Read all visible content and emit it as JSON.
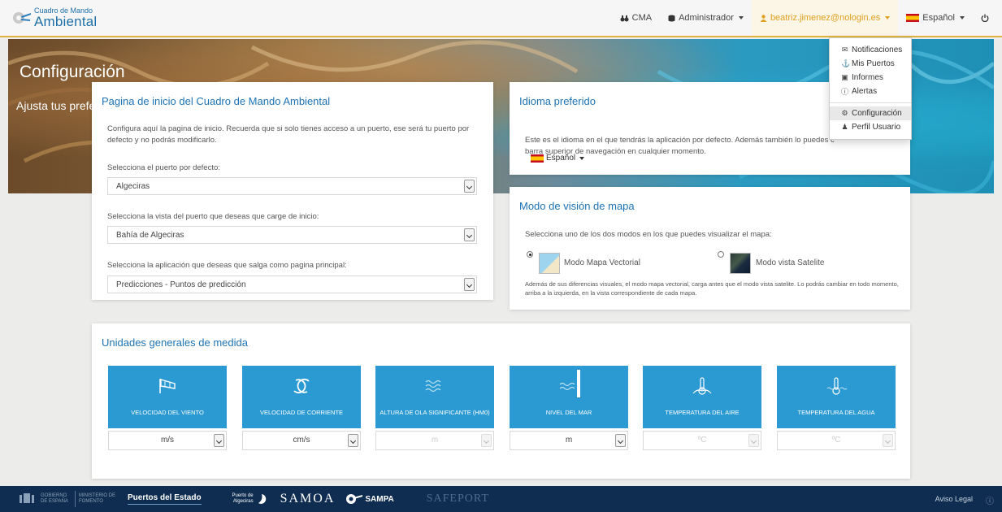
{
  "navbar": {
    "brand_small": "Cuadro de Mando",
    "brand_big": "Ambiental",
    "cma_label": "CMA",
    "admin_label": "Administrador",
    "user_label": "beatriz.jimenez@nologin.es",
    "language_label": "Español"
  },
  "user_menu": {
    "items": [
      {
        "label": "Notificaciones",
        "icon": "envelope-icon"
      },
      {
        "label": "Mis Puertos",
        "icon": "anchor-icon"
      },
      {
        "label": "Informes",
        "icon": "report-icon"
      },
      {
        "label": "Alertas",
        "icon": "alert-icon"
      },
      {
        "label": "Configuración",
        "icon": "gear-icon"
      },
      {
        "label": "Perfil Usuario",
        "icon": "user-icon"
      }
    ]
  },
  "hero": {
    "title": "Configuración",
    "subtitle": "Ajusta tus prefe"
  },
  "home_card": {
    "title": "Pagina de inicio del Cuadro de Mando Ambiental",
    "description": "Configura aquí la pagina de inicio. Recuerda que si solo tienes acceso a un puerto, ese será tu puerto por defecto y no podrás modificarlo.",
    "port_label": "Selecciona el puerto por defecto:",
    "port_value": "Algeciras",
    "view_label": "Selecciona la vista del puerto que deseas que carge de inicio:",
    "view_value": "Bahía de Algeciras",
    "app_label": "Selecciona la aplicación que deseas que salga como pagina principal:",
    "app_value": "Predicciones - Puntos de predicción"
  },
  "language_card": {
    "title": "Idioma preferido",
    "description": "Este es el idioma en el que tendrás la aplicación por defecto. Además también lo puedes c barra superior de navegación en cualquier momento.",
    "language_value": "Español"
  },
  "map_card": {
    "title": "Modo de visión de mapa",
    "description": "Selecciona uno de los dos modos en los que puedes visualizar el mapa:",
    "vector_label": "Modo Mapa Vectorial",
    "satellite_label": "Modo vista Satelite",
    "note": "Además de sus diferencias visuales, el modo mapa vectorial, carga antes que el modo vista satelite. Lo podrás cambiar en todo momento, arriba a la izquierda, en la vista correspondiente de cada mapa.",
    "selected": "vector"
  },
  "units_card": {
    "title": "Unidades generales de medida",
    "tiles": [
      {
        "label": "VELOCIDAD DEL VIENTO",
        "unit": "m/s",
        "icon": "windsock-icon",
        "enabled": true
      },
      {
        "label": "VELOCIDAD DE CORRIENTE",
        "unit": "cm/s",
        "icon": "refresh-icon",
        "enabled": true
      },
      {
        "label": "ALTURA DE OLA SIGNIFICANTE (HM0)",
        "unit": "m",
        "icon": "waves-icon",
        "enabled": false
      },
      {
        "label": "NIVEL DEL MAR",
        "unit": "m",
        "icon": "sea-level-icon",
        "enabled": true
      },
      {
        "label": "TEMPERATURA DEL AIRE",
        "unit": "ºC",
        "icon": "air-temperature-icon",
        "enabled": false
      },
      {
        "label": "TEMPERATURA DEL AGUA",
        "unit": "ºC",
        "icon": "water-temperature-icon",
        "enabled": false
      }
    ]
  },
  "footer": {
    "gobierno": "GOBIERNO DE ESPAÑA",
    "ministerio": "MINISTERIO DE FOMENTO",
    "puertos": "Puertos del Estado",
    "algeciras": "Puerto de Algeciras",
    "samoa": "SAMOA",
    "sampa": "SAMPA",
    "safeport": "SAFEPORT",
    "legal": "Aviso Legal"
  },
  "colors": {
    "accent": "#1e73b4",
    "tile": "#2b9ad3",
    "footer": "#0f2d50",
    "user_highlight": "#e0a020"
  }
}
